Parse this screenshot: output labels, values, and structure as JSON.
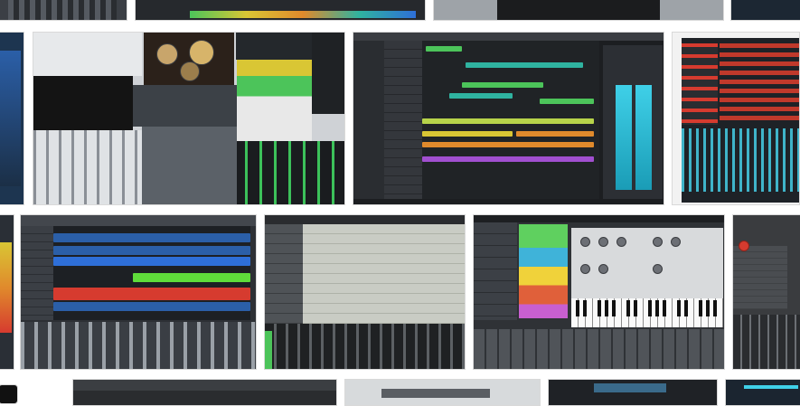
{
  "page": {
    "title": ""
  },
  "results": [
    {
      "id": "r1",
      "kind": "top strip"
    },
    {
      "id": "r2",
      "kind": "top strip"
    },
    {
      "id": "r3",
      "kind": "top strip"
    },
    {
      "id": "r4",
      "kind": "top strip"
    },
    {
      "id": "r5",
      "kind": "top strip"
    },
    {
      "id": "r6",
      "kind": "collage"
    },
    {
      "id": "r7",
      "kind": "arrange"
    },
    {
      "id": "r8",
      "kind": "arrange-mixer"
    },
    {
      "id": "r9",
      "kind": "arrange-mixer"
    },
    {
      "id": "r10",
      "kind": "mixer-edit"
    },
    {
      "id": "r11",
      "kind": "synth"
    },
    {
      "id": "r12",
      "kind": "menu"
    }
  ],
  "tile_text": {
    "tile2_caption": "",
    "tile7_caption": "",
    "tile8_caption": "",
    "tile9_caption": "",
    "tile10_caption": "",
    "tile11_caption": "",
    "bottom_tile_caption": ""
  },
  "colors": {
    "track_green": "#4cc45a",
    "track_teal": "#2fb3a0",
    "track_yellow": "#d9c634",
    "track_orange": "#e08a2c",
    "track_purple": "#a14fd0",
    "track_blue": "#2e6fd8",
    "meter_cyan": "#3fd0e8",
    "cubase_bg": "#1e2a33",
    "studio_one_blue": "#2b5fa8",
    "record_red": "#d63b2f"
  }
}
